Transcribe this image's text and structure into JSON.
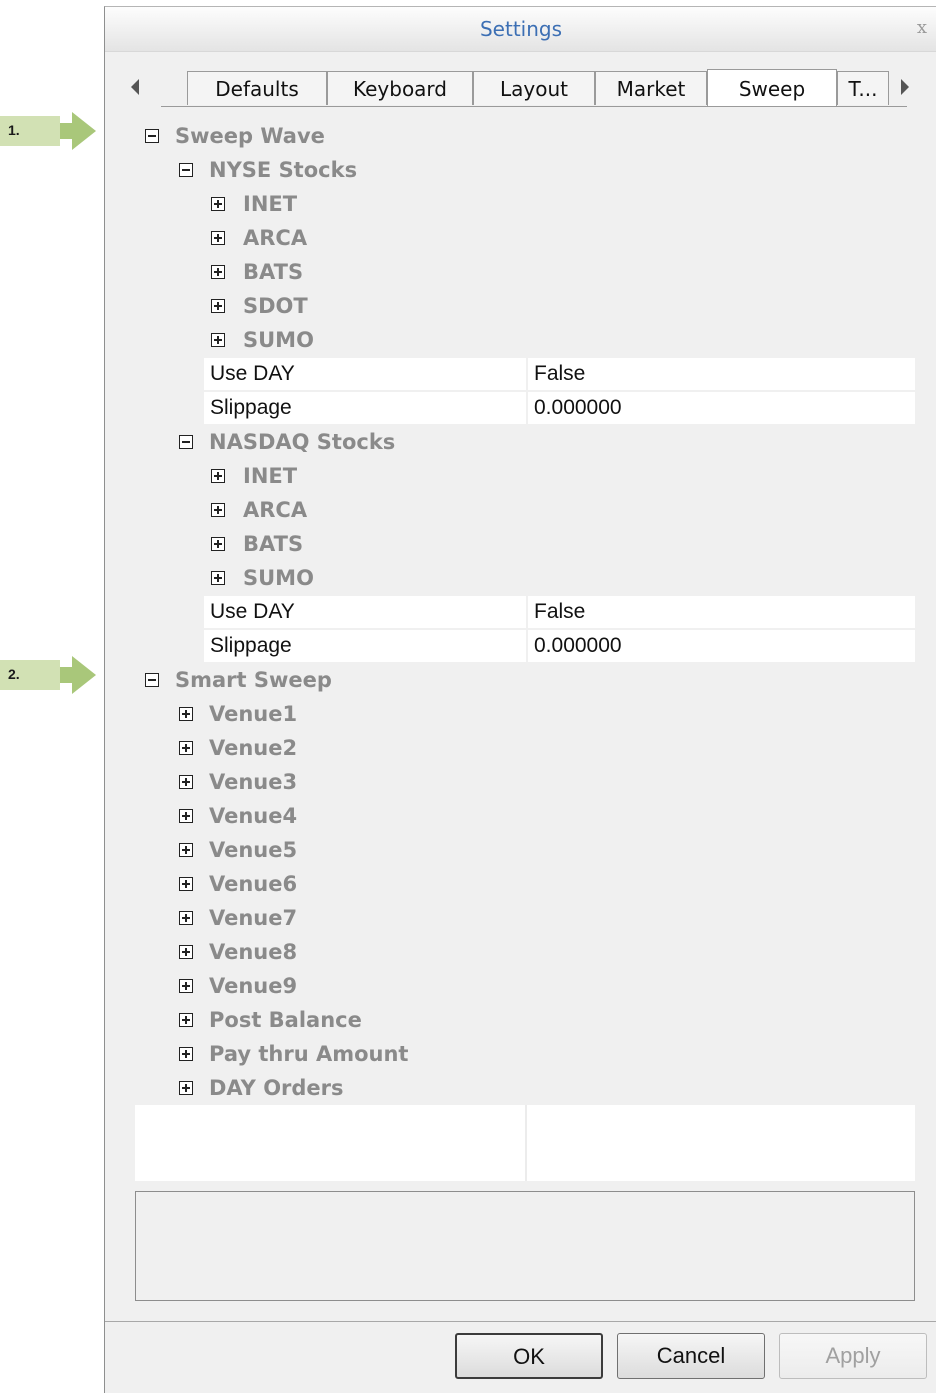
{
  "annotations": [
    "1.",
    "2."
  ],
  "dialog": {
    "title": "Settings",
    "close_glyph": "x"
  },
  "tabs": [
    {
      "label": "Defaults",
      "active": false
    },
    {
      "label": "Keyboard",
      "active": false
    },
    {
      "label": "Layout",
      "active": false
    },
    {
      "label": "Market",
      "active": false
    },
    {
      "label": "Sweep",
      "active": true
    },
    {
      "label": "T...",
      "active": false
    }
  ],
  "tree": {
    "sweep_wave": {
      "label": "Sweep Wave",
      "nyse": {
        "label": "NYSE Stocks",
        "children": [
          "INET",
          "ARCA",
          "BATS",
          "SDOT",
          "SUMO"
        ],
        "props": [
          {
            "name": "Use DAY",
            "value": "False"
          },
          {
            "name": "Slippage",
            "value": "0.000000"
          }
        ]
      },
      "nasdaq": {
        "label": "NASDAQ Stocks",
        "children": [
          "INET",
          "ARCA",
          "BATS",
          "SUMO"
        ],
        "props": [
          {
            "name": "Use DAY",
            "value": "False"
          },
          {
            "name": "Slippage",
            "value": "0.000000"
          }
        ]
      }
    },
    "smart_sweep": {
      "label": "Smart Sweep",
      "children": [
        "Venue1",
        "Venue2",
        "Venue3",
        "Venue4",
        "Venue5",
        "Venue6",
        "Venue7",
        "Venue8",
        "Venue9",
        "Post Balance",
        "Pay thru Amount",
        "DAY Orders"
      ]
    }
  },
  "buttons": {
    "ok": "OK",
    "cancel": "Cancel",
    "apply": "Apply"
  }
}
